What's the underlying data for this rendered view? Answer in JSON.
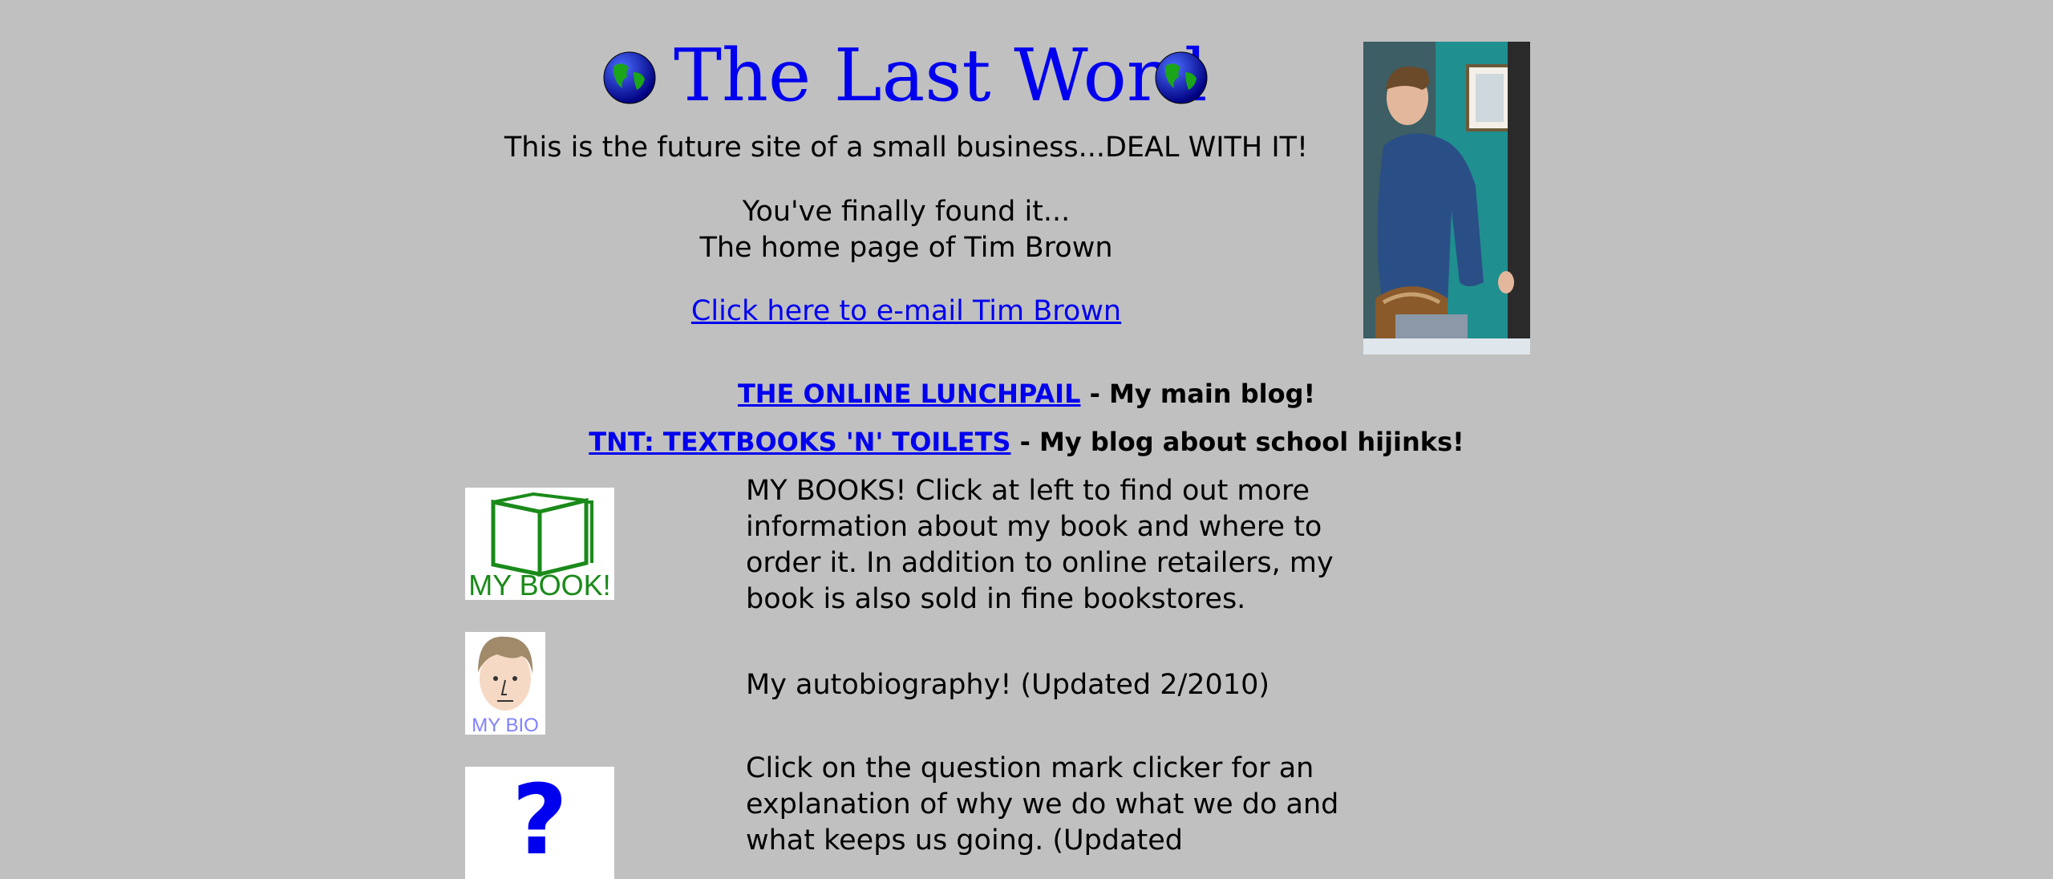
{
  "header": {
    "title": "The Last Word",
    "tagline": "This is the future site of a small business...DEAL WITH IT!",
    "intro_line1": "You've finally found it...",
    "intro_line2": "The home page of Tim Brown",
    "email_link": "Click here to e-mail Tim Brown"
  },
  "blogs": [
    {
      "link": "THE ONLINE LUNCHPAIL",
      "desc": " - My main blog!"
    },
    {
      "link": "TNT: TEXTBOOKS 'N' TOILETS",
      "desc": " - My blog about school hijinks!"
    }
  ],
  "sections": [
    {
      "icon_text": "MY BOOK!",
      "text": "MY BOOKS! Click at left to find out more information about my book and where to order it. In addition to online retailers, my book is also sold in fine bookstores."
    },
    {
      "icon_text": "MY BIO",
      "text": "My autobiography! (Updated 2/2010)"
    },
    {
      "icon_text": "?",
      "text": "Click on the question mark clicker for an explanation of why we do what we do and what keeps us going. (Updated"
    }
  ],
  "colors": {
    "background": "#c0c0c0",
    "link": "#0000ee",
    "book_green": "#1a8a1a",
    "bio_text": "#8080ff"
  }
}
